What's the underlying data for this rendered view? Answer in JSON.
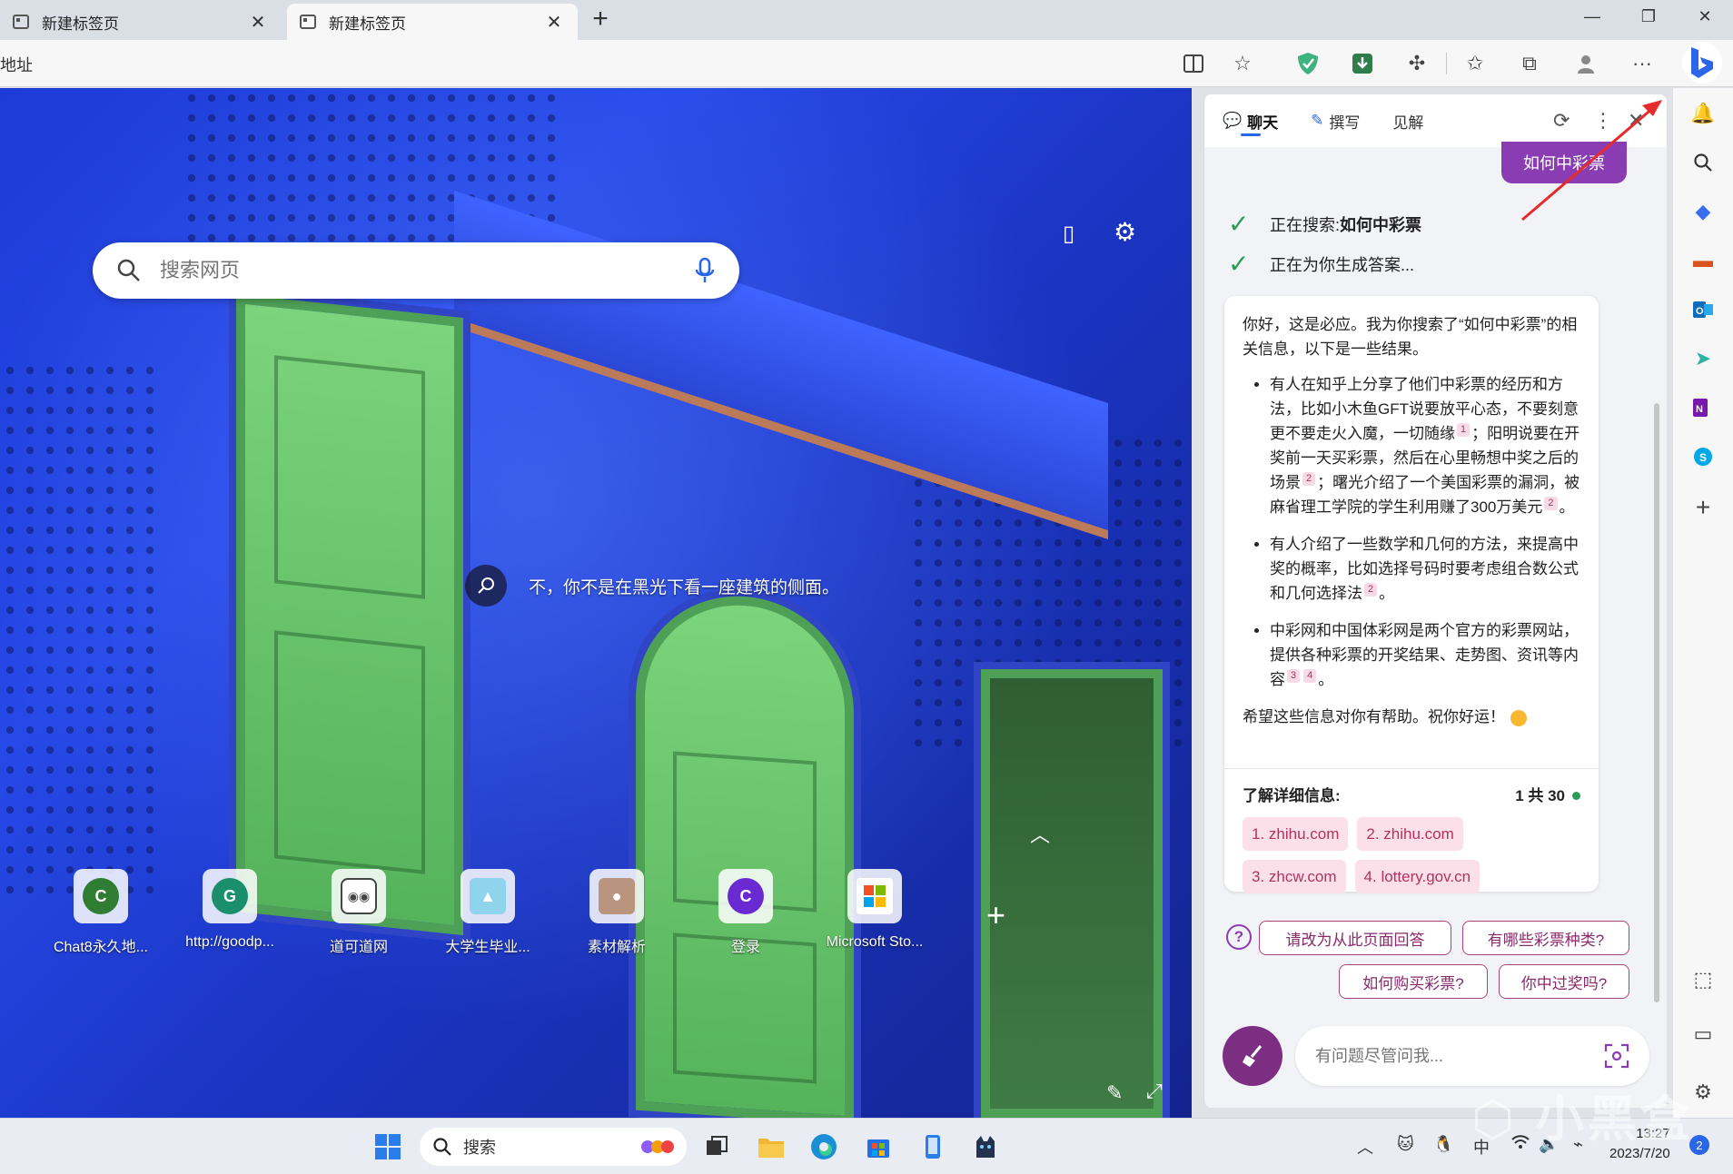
{
  "tabs": [
    {
      "title": "新建标签页",
      "active": false
    },
    {
      "title": "新建标签页",
      "active": true
    }
  ],
  "address": {
    "text": "地址"
  },
  "page": {
    "search_placeholder": "搜索网页",
    "caption": "不，你不是在黑光下看一座建筑的侧面。",
    "tiles": [
      {
        "label": "Chat8永久地...",
        "letter": "C",
        "color": "#2e7d32"
      },
      {
        "label": "http://goodp...",
        "letter": "G",
        "color": "#1b8f6c"
      },
      {
        "label": "道可道网",
        "letter": "",
        "color": "#444444"
      },
      {
        "label": "大学生毕业...",
        "letter": "",
        "color": "#4aa3c9"
      },
      {
        "label": "素材解析",
        "letter": "",
        "color": "#8b6b55"
      },
      {
        "label": "登录",
        "letter": "C",
        "color": "#6a2ad1"
      },
      {
        "label": "Microsoft Sto...",
        "letter": "",
        "color": "#f25022"
      }
    ]
  },
  "copilot": {
    "tabs": {
      "chat": "聊天",
      "compose": "撰写",
      "insights": "见解"
    },
    "user_message": "如何中彩票",
    "status_searching_prefix": "正在搜索: ",
    "status_searching_query": "如何中彩票",
    "status_generating": "正在为你生成答案...",
    "answer": {
      "intro": "你好，这是必应。我为你搜索了“如何中彩票”的相关信息，以下是一些结果。",
      "b1_a": "有人在知乎上分享了他们中彩票的经历和方法，比如小木鱼GFT说要放平心态，不要刻意更不要走火入魔，一切随缘",
      "b1_c1": "1",
      "b1_b": "；阳明说要在开奖前一天买彩票，然后在心里畅想中奖之后的场景",
      "b1_c2": "2",
      "b1_c": "；曙光介绍了一个美国彩票的漏洞，被麻省理工学院的学生利用赚了300万美元",
      "b1_c3": "2",
      "b1_d": "。",
      "b2_a": "有人介绍了一些数学和几何的方法，来提高中奖的概率，比如选择号码时要考虑组合数公式和几何选择法",
      "b2_c1": "2",
      "b2_b": "。",
      "b3_a": "中彩网和中国体彩网是两个官方的彩票网站，提供各种彩票的开奖结果、走势图、资讯等内容",
      "b3_c1": "3",
      "b3_c2": "4",
      "b3_b": "。",
      "outro": "希望这些信息对你有帮助。祝你好运！",
      "more_title": "了解详细信息:",
      "count": "1 共 30",
      "links": [
        "1. zhihu.com",
        "2. zhihu.com",
        "3. zhcw.com",
        "4. lottery.gov.cn"
      ]
    },
    "suggestions": [
      "请改为从此页面回答",
      "有哪些彩票种类?",
      "如何购买彩票?",
      "你中过奖吗?"
    ],
    "ask_placeholder": "有问题尽管问我..."
  },
  "taskbar": {
    "search_label": "搜索",
    "time": "13:27",
    "date": "2023/7/20",
    "ime": "中",
    "notifications": "2"
  },
  "watermark": "小黑盒",
  "colors": {
    "accent": "#8a3db3",
    "cite": "#b3325f",
    "bing": "#2b66e8"
  }
}
